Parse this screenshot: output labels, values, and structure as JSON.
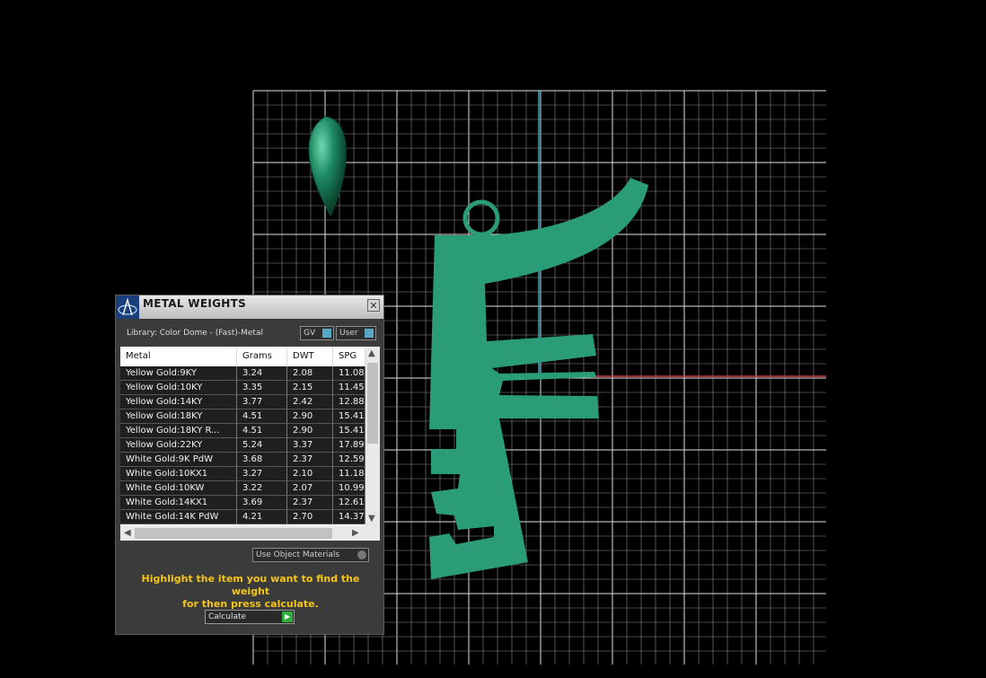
{
  "panel": {
    "title": "METAL WEIGHTS",
    "library_label": "Library: Color Dome - (Fast)-Metal",
    "toggle_gv": "GV",
    "toggle_user": "User",
    "columns": [
      "Metal",
      "Grams",
      "DWT",
      "SPG"
    ],
    "rows": [
      {
        "metal": "Yellow Gold:9KY",
        "grams": "3.24",
        "dwt": "2.08",
        "spg": "11.08"
      },
      {
        "metal": "Yellow Gold:10KY",
        "grams": "3.35",
        "dwt": "2.15",
        "spg": "11.45"
      },
      {
        "metal": "Yellow Gold:14KY",
        "grams": "3.77",
        "dwt": "2.42",
        "spg": "12.88"
      },
      {
        "metal": "Yellow Gold:18KY",
        "grams": "4.51",
        "dwt": "2.90",
        "spg": "15.41"
      },
      {
        "metal": "Yellow Gold:18KY R...",
        "grams": "4.51",
        "dwt": "2.90",
        "spg": "15.41"
      },
      {
        "metal": "Yellow Gold:22KY",
        "grams": "5.24",
        "dwt": "3.37",
        "spg": "17.89"
      },
      {
        "metal": "White Gold:9K PdW",
        "grams": "3.68",
        "dwt": "2.37",
        "spg": "12.59"
      },
      {
        "metal": "White Gold:10KX1",
        "grams": "3.27",
        "dwt": "2.10",
        "spg": "11.18"
      },
      {
        "metal": "White Gold:10KW",
        "grams": "3.22",
        "dwt": "2.07",
        "spg": "10.99"
      },
      {
        "metal": "White Gold:14KX1",
        "grams": "3.69",
        "dwt": "2.37",
        "spg": "12.61"
      },
      {
        "metal": "White Gold:14K PdW",
        "grams": "4.21",
        "dwt": "2.70",
        "spg": "14.37"
      }
    ],
    "use_object_materials": "Use Object Materials",
    "hint_line1": "Highlight the item you want to find the weight",
    "hint_line2": "for then press calculate.",
    "calculate": "Calculate"
  },
  "colors": {
    "model": "#2a9c77",
    "grid": "#d8d8d8",
    "axis_y": "#2ab0c8",
    "axis_x": "#c83a3a",
    "hint": "#f5c518"
  }
}
